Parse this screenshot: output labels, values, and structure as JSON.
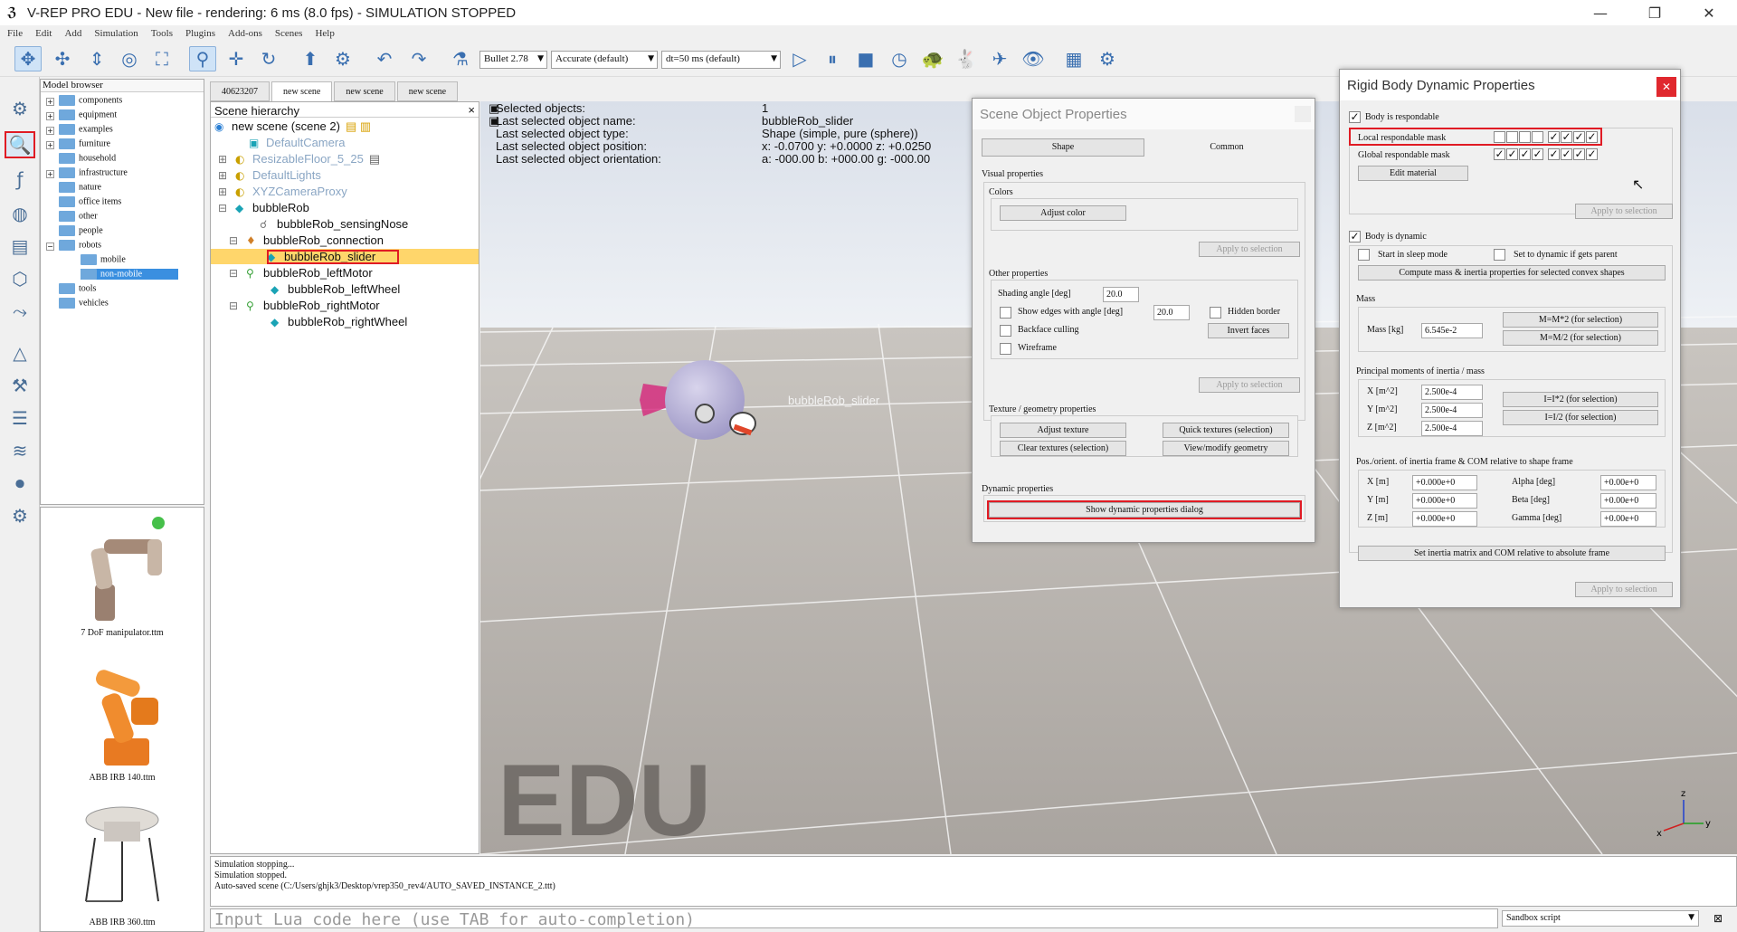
{
  "window": {
    "title": "V-REP PRO EDU - New file - rendering: 6 ms (8.0 fps) - SIMULATION STOPPED",
    "minimize": "—",
    "restore": "❐",
    "close": "✕"
  },
  "menu": [
    "File",
    "Edit",
    "Add",
    "Simulation",
    "Tools",
    "Plugins",
    "Add-ons",
    "Scenes",
    "Help"
  ],
  "toolbar": {
    "engine": "Bullet 2.78",
    "accuracy": "Accurate (default)",
    "timestep": "dt=50 ms (default)"
  },
  "model_browser": {
    "title": "Model browser",
    "items": [
      "components",
      "equipment",
      "examples",
      "furniture",
      "household",
      "infrastructure",
      "nature",
      "office items",
      "other",
      "people",
      "robots",
      "mobile",
      "non-mobile",
      "tools",
      "vehicles"
    ]
  },
  "thumbnails": [
    "7 DoF manipulator.ttm",
    "ABB IRB 140.ttm",
    "ABB IRB 360.ttm"
  ],
  "scene_tabs": [
    "40623207",
    "new scene",
    "new scene",
    "new scene"
  ],
  "hierarchy": {
    "title": "Scene hierarchy",
    "close": "×",
    "items": [
      "new scene (scene 2)",
      "DefaultCamera",
      "ResizableFloor_5_25",
      "DefaultLights",
      "XYZCameraProxy",
      "bubbleRob",
      "bubbleRob_sensingNose",
      "bubbleRob_connection",
      "bubbleRob_slider",
      "bubbleRob_leftMotor",
      "bubbleRob_leftWheel",
      "bubbleRob_rightMotor",
      "bubbleRob_rightWheel"
    ]
  },
  "info": {
    "labels": [
      "Selected objects:",
      "Last selected object name:",
      "Last selected object type:",
      "Last selected object position:",
      "Last selected object orientation:"
    ],
    "values": [
      "1",
      "bubbleRob_slider",
      "Shape (simple, pure (sphere))",
      "x: -0.0700    y: +0.0000    z: +0.0250",
      "a: -000.00    b: +000.00    g: -000.00"
    ],
    "object_label": "bubbleRob_slider"
  },
  "watermark": "EDU",
  "axes": {
    "x": "x",
    "y": "y",
    "z": "z"
  },
  "scene_props": {
    "title": "Scene Object Properties",
    "tab_shape": "Shape",
    "tab_common": "Common",
    "visual": "Visual properties",
    "colors": "Colors",
    "adjust_color": "Adjust color",
    "apply1": "Apply to selection",
    "other": "Other properties",
    "shading": "Shading angle [deg]",
    "shading_val": "20.0",
    "edges": "Show edges with angle [deg]",
    "edges_val": "20.0",
    "hidden_border": "Hidden border",
    "backface": "Backface culling",
    "invert": "Invert faces",
    "wireframe": "Wireframe",
    "apply2": "Apply to selection",
    "texture": "Texture / geometry properties",
    "adjust_texture": "Adjust texture",
    "quick_textures": "Quick textures (selection)",
    "clear_textures": "Clear textures (selection)",
    "view_geometry": "View/modify geometry",
    "dynamic": "Dynamic properties",
    "show_dyn": "Show dynamic properties dialog"
  },
  "rigid": {
    "title": "Rigid Body Dynamic Properties",
    "close": "✕",
    "respondable": "Body is respondable",
    "local_mask": "Local respondable mask",
    "global_mask": "Global respondable mask",
    "edit_material": "Edit material",
    "apply1": "Apply to selection",
    "dynamic": "Body is dynamic",
    "sleep": "Start in sleep mode",
    "set_dynamic": "Set to dynamic if gets parent",
    "compute": "Compute mass & inertia properties for selected convex shapes",
    "mass_group": "Mass",
    "mass_label": "Mass [kg]",
    "mass_val": "6.545e-2",
    "mass_x2": "M=M*2  (for selection)",
    "mass_div2": "M=M/2  (for selection)",
    "inertia_group": "Principal moments of inertia / mass",
    "ix": "X [m^2]",
    "iy": "Y [m^2]",
    "iz": "Z [m^2]",
    "ix_val": "2.500e-4",
    "iy_val": "2.500e-4",
    "iz_val": "2.500e-4",
    "i_x2": "I=I*2  (for selection)",
    "i_div2": "I=I/2  (for selection)",
    "pos_group": "Pos./orient. of inertia frame & COM relative to shape frame",
    "px": "X [m]",
    "py": "Y [m]",
    "pz": "Z [m]",
    "px_val": "+0.000e+0",
    "py_val": "+0.000e+0",
    "pz_val": "+0.000e+0",
    "alpha": "Alpha [deg]",
    "beta": "Beta [deg]",
    "gamma": "Gamma [deg]",
    "alpha_val": "+0.00e+0",
    "beta_val": "+0.00e+0",
    "gamma_val": "+0.00e+0",
    "set_inertia": "Set inertia matrix and COM relative to absolute frame",
    "apply2": "Apply to selection"
  },
  "console": [
    "Simulation stopping...",
    "Simulation stopped.",
    "Auto-saved scene (C:/Users/ghjk3/Desktop/vrep350_rev4/AUTO_SAVED_INSTANCE_2.ttt)"
  ],
  "lua": {
    "placeholder": "Input Lua code here (use TAB for auto-completion)",
    "script": "Sandbox script"
  }
}
